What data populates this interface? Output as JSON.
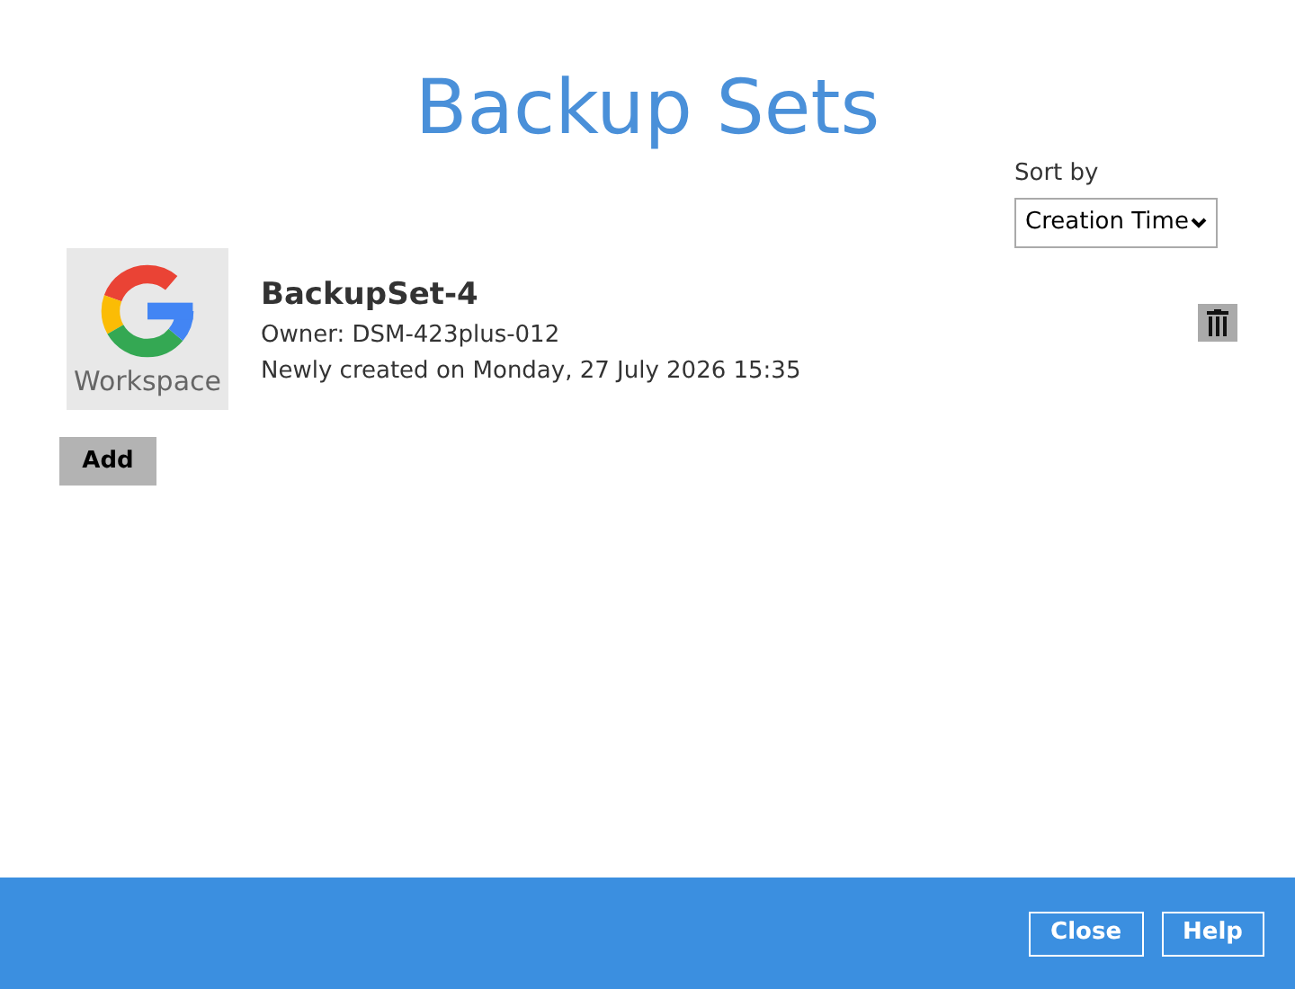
{
  "title": "Backup Sets",
  "sort": {
    "label": "Sort by",
    "value": "Creation Time"
  },
  "backup_sets": [
    {
      "logo_caption": "Workspace",
      "name": "BackupSet-4",
      "owner": "Owner: DSM-423plus-012",
      "created": "Newly created on Monday, 27 July 2026 15:35"
    }
  ],
  "add_button": "Add",
  "footer_buttons": [
    "Close",
    "Help"
  ]
}
